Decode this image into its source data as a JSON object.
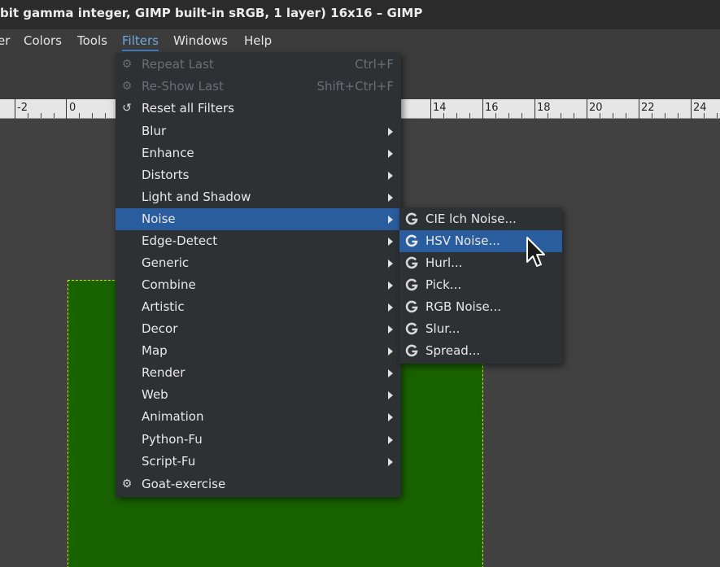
{
  "window": {
    "title": "bit gamma integer, GIMP built-in sRGB, 1 layer) 16x16 – GIMP"
  },
  "menubar": {
    "items": [
      {
        "label": "er"
      },
      {
        "label": "Colors"
      },
      {
        "label": "Tools"
      },
      {
        "label": "Filters",
        "active": true
      },
      {
        "label": "Windows"
      },
      {
        "label": "Help"
      }
    ]
  },
  "ruler": {
    "labels": [
      "-2",
      "0",
      "14",
      "16",
      "18",
      "20",
      "22",
      "24"
    ]
  },
  "filters_menu": {
    "items": [
      {
        "label": "Repeat Last",
        "accel": "Ctrl+F",
        "icon": "gear-icon",
        "disabled": true
      },
      {
        "label": "Re-Show Last",
        "accel": "Shift+Ctrl+F",
        "icon": "reshow-icon",
        "disabled": true
      },
      {
        "label": "Reset all Filters",
        "icon": "reset-icon"
      },
      {
        "label": "Blur",
        "submenu": true
      },
      {
        "label": "Enhance",
        "submenu": true
      },
      {
        "label": "Distorts",
        "submenu": true
      },
      {
        "label": "Light and Shadow",
        "submenu": true
      },
      {
        "label": "Noise",
        "submenu": true,
        "highlight": true
      },
      {
        "label": "Edge-Detect",
        "submenu": true
      },
      {
        "label": "Generic",
        "submenu": true
      },
      {
        "label": "Combine",
        "submenu": true
      },
      {
        "label": "Artistic",
        "submenu": true
      },
      {
        "label": "Decor",
        "submenu": true
      },
      {
        "label": "Map",
        "submenu": true
      },
      {
        "label": "Render",
        "submenu": true
      },
      {
        "label": "Web",
        "submenu": true
      },
      {
        "label": "Animation",
        "submenu": true
      },
      {
        "label": "Python-Fu",
        "submenu": true
      },
      {
        "label": "Script-Fu",
        "submenu": true
      },
      {
        "label": "Goat-exercise",
        "icon": "gear-icon"
      }
    ]
  },
  "noise_menu": {
    "items": [
      {
        "label": "CIE lch Noise...",
        "icon": "gegl-icon"
      },
      {
        "label": "HSV Noise...",
        "icon": "gegl-icon",
        "highlight": true
      },
      {
        "label": "Hurl...",
        "icon": "gegl-icon"
      },
      {
        "label": "Pick...",
        "icon": "gegl-icon"
      },
      {
        "label": "RGB Noise...",
        "icon": "gegl-icon"
      },
      {
        "label": "Slur...",
        "icon": "gegl-icon"
      },
      {
        "label": "Spread...",
        "icon": "gegl-icon"
      }
    ]
  },
  "colors": {
    "highlight": "#2a5d9e",
    "menu_bg": "#2e3134",
    "layer_fill": "#196200",
    "layer_boundary": "#e2e200"
  }
}
